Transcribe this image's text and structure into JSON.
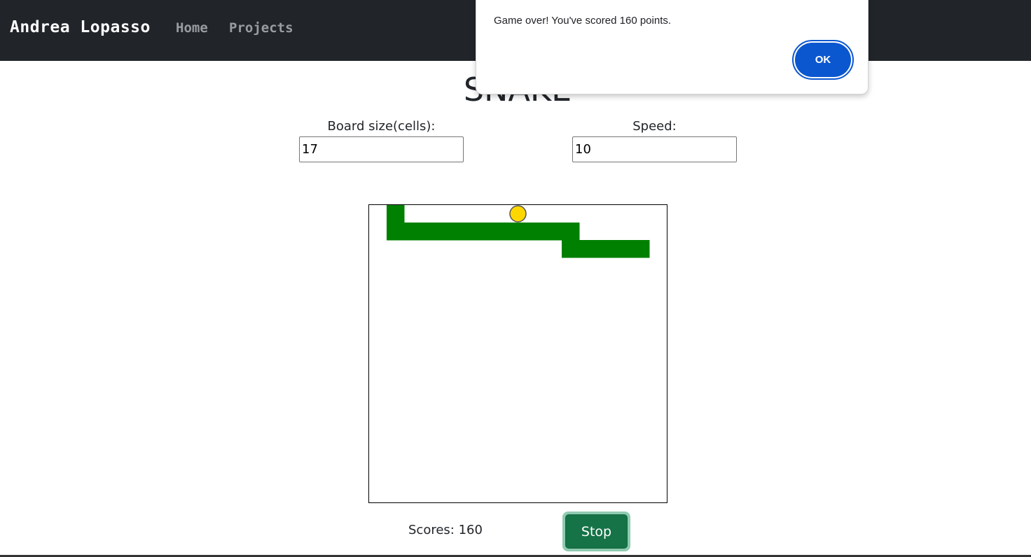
{
  "navbar": {
    "brand": "Andrea Lopasso",
    "links": [
      "Home",
      "Projects"
    ]
  },
  "page": {
    "title": "SNAKE"
  },
  "controls": {
    "board_size_label": "Board size(cells):",
    "board_size_value": "17",
    "speed_label": "Speed:",
    "speed_value": "10"
  },
  "game": {
    "board_cells": 17,
    "snake_cells": [
      [
        1,
        0
      ],
      [
        1,
        1
      ],
      [
        2,
        1
      ],
      [
        3,
        1
      ],
      [
        4,
        1
      ],
      [
        5,
        1
      ],
      [
        6,
        1
      ],
      [
        7,
        1
      ],
      [
        8,
        1
      ],
      [
        9,
        1
      ],
      [
        10,
        1
      ],
      [
        11,
        1
      ],
      [
        11,
        2
      ],
      [
        12,
        2
      ],
      [
        13,
        2
      ],
      [
        14,
        2
      ],
      [
        15,
        2
      ]
    ],
    "food_cell": [
      8,
      0
    ],
    "snake_color": "#008000",
    "food_color": "#ffd700"
  },
  "footer": {
    "scores_label": "Scores:",
    "scores_value": "160",
    "stop_label": "Stop"
  },
  "dialog": {
    "message": "Game over! You've scored 160 points.",
    "ok_label": "OK"
  }
}
